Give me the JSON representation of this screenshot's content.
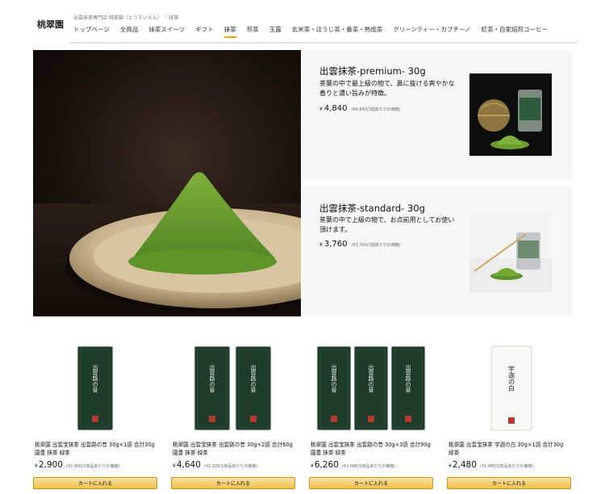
{
  "header": {
    "logo": "桃翠園",
    "breadcrumb": [
      "出雲抹茶専門店 桃翠園（とうすいえん）",
      "›",
      "抹茶"
    ],
    "nav": [
      {
        "label": "トップページ",
        "active": false
      },
      {
        "label": "全商品",
        "active": false
      },
      {
        "label": "抹茶スイーツ",
        "active": false
      },
      {
        "label": "ギフト",
        "active": false
      },
      {
        "label": "抹茶",
        "active": true
      },
      {
        "label": "煎茶",
        "active": false
      },
      {
        "label": "玉露",
        "active": false
      },
      {
        "label": "玄米茶・ほうじ茶・番茶・熟成茶",
        "active": false
      },
      {
        "label": "グリーンティー・カプチーノ",
        "active": false
      },
      {
        "label": "紅茶・自家焙煎コーヒー",
        "active": false
      }
    ]
  },
  "features": [
    {
      "title": "出雲抹茶-premium- 30g",
      "desc": "茶葉の中で最上級の物で、鼻に抜ける爽やかな香りと濃い旨みが特徴。",
      "yen": "¥",
      "price": "4,840",
      "unit_price": "(¥4,840/1個あたりの価格)"
    },
    {
      "title": "出雲抹茶-standard- 30g",
      "desc": "茶葉の中で上級の物で、お点前用としてお使い頂けます。",
      "yen": "¥",
      "price": "3,760",
      "unit_price": "(¥3,760/1個あたりの価格)"
    }
  ],
  "products": [
    {
      "title": "桃翠園 出雲宝抹茶 出雲路の昔 30g×1語 合計30g 園豊 抹茶 緑茶",
      "yen": "¥",
      "price": "2,900",
      "unit_price": "(¥2,900/1商品あたりの価格)",
      "cart": "カートに入れる",
      "packs": 1,
      "pack_label": "出雲路の昔"
    },
    {
      "title": "桃翠園 出雲宝抹茶 出雲路の昔 30g×2語 合計60g 園豊 抹茶 緑茶",
      "yen": "¥",
      "price": "4,640",
      "unit_price": "(¥2,320/1商品あたりの価格)",
      "cart": "カートに入れる",
      "packs": 2,
      "pack_label": "出雲路の昔"
    },
    {
      "title": "桃翠園 出雲宝抹茶 出雲路の昔 30g×3語 合計90g 園豊 抹茶 緑茶",
      "yen": "¥",
      "price": "6,260",
      "unit_price": "(¥2,086/1商品あたりの価格)",
      "cart": "カートに入れる",
      "packs": 3,
      "pack_label": "出雲路の昔"
    },
    {
      "title": "桃翠園 出雲宝抹茶 宇迦の白 30g×1語 合計30g 緑茶",
      "yen": "¥",
      "price": "2,480",
      "unit_price": "(¥2,480/1商品あたりの価格)",
      "cart": "カートに入れる",
      "packs": 1,
      "pack_label": "宇迦の白"
    }
  ],
  "colors": {
    "accent": "#ff9900",
    "matcha": "#5b8f2a",
    "package_dark": "#1f3b2a",
    "button_top": "#f7dfa5",
    "button_bottom": "#f0c14b"
  }
}
